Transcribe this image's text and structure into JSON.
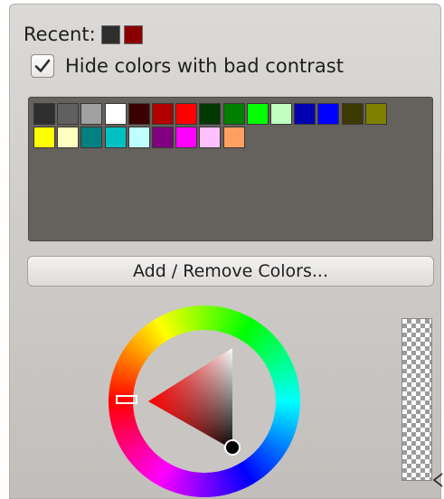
{
  "recent": {
    "label": "Recent:",
    "colors": [
      "#2e2e2e",
      "#8a0000"
    ]
  },
  "hide_bad_contrast": {
    "label": "Hide colors with bad contrast",
    "checked": true
  },
  "palette": {
    "background": "#65615d",
    "colors": [
      "#2e2e2e",
      "#606060",
      "#a0a0a0",
      "#ffffff",
      "#3b0000",
      "#b00000",
      "#ff0000",
      "#003800",
      "#008000",
      "#00ff00",
      "#c0ffc0",
      "#0000b0",
      "#0000ff",
      "#3b3800",
      "#808000",
      "#ffff00",
      "#ffffc0",
      "#008080",
      "#00c0c0",
      "#c0ffff",
      "#800080",
      "#ff00ff",
      "#ffc0ff",
      "#ffa060"
    ]
  },
  "add_remove_button": {
    "label": "Add / Remove Colors..."
  },
  "color_selector": {
    "hue_color": "#ff0000",
    "selected_color": "#000000"
  }
}
